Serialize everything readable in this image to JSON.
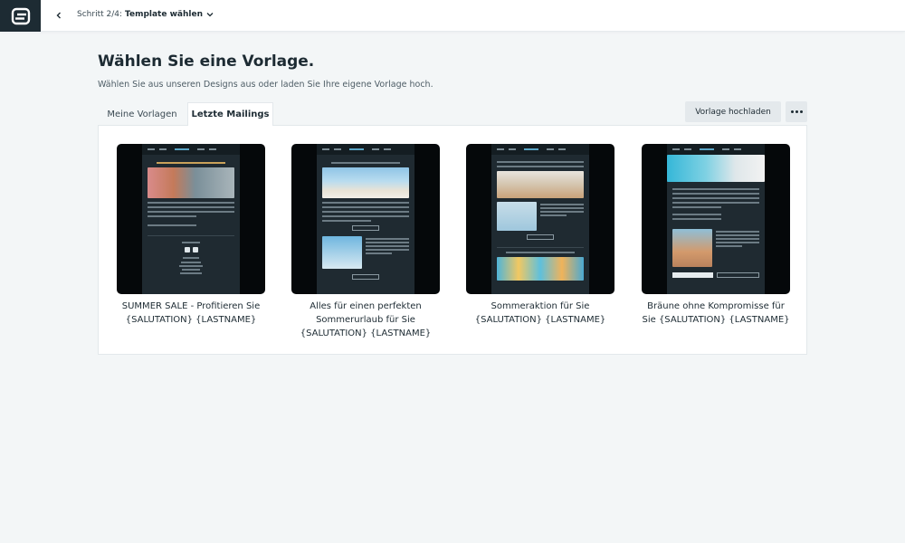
{
  "header": {
    "step_prefix": "Schritt 2/4:",
    "step_title": "Template wählen"
  },
  "page": {
    "title": "Wählen Sie eine Vorlage.",
    "subtitle": "Wählen Sie aus unseren Designs aus oder laden Sie Ihre eigene Vorlage hoch."
  },
  "tabs": [
    {
      "label": "Meine Vorlagen",
      "active": false
    },
    {
      "label": "Letzte Mailings",
      "active": true
    }
  ],
  "actions": {
    "upload_label": "Vorlage hochladen"
  },
  "templates": [
    {
      "caption": "SUMMER SALE - Profitieren Sie {SALUTATION} {LASTNAME}"
    },
    {
      "caption": "Alles für einen perfekten Sommerurlaub für Sie {SALUTATION} {LASTNAME}"
    },
    {
      "caption": "Sommeraktion für Sie {SALUTATION} {LASTNAME}"
    },
    {
      "caption": "Bräune ohne Kompromisse für Sie {SALUTATION} {LASTNAME}"
    }
  ],
  "colors": {
    "background": "#f3f6f7",
    "logo_bg": "#1d2b33",
    "thumb_bg": "#05080a",
    "email_bg": "#1f2a31"
  }
}
